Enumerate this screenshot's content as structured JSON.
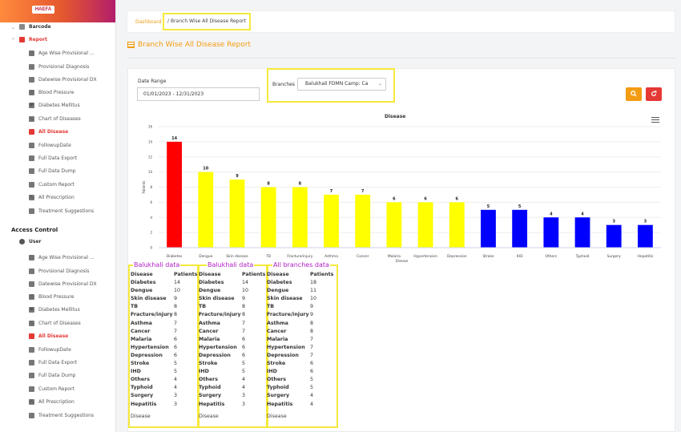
{
  "app": {
    "logo_text": "HAEFA"
  },
  "sidebar": {
    "barcode": "Barcode",
    "report": "Report",
    "report_items": [
      {
        "label": "Age Wise Provisional ...",
        "icon": "people-icon"
      },
      {
        "label": "Provisional Diagnosis",
        "icon": "document-icon"
      },
      {
        "label": "Datewise Provisional DX",
        "icon": "calendar-icon"
      },
      {
        "label": "Blood Pressure",
        "icon": "blood-pressure-icon"
      },
      {
        "label": "Diabetes Mellitus",
        "icon": "heart-icon"
      },
      {
        "label": "Chart of Diseases",
        "icon": "stethoscope-icon"
      },
      {
        "label": "All Disease",
        "icon": "clipboard-icon"
      },
      {
        "label": "FollowupDate",
        "icon": "calendar-icon"
      },
      {
        "label": "Full Data Export",
        "icon": "export-icon"
      },
      {
        "label": "Full Data Dump",
        "icon": "database-icon"
      },
      {
        "label": "Custom Report",
        "icon": "file-icon"
      },
      {
        "label": "All Prescription",
        "icon": "prescription-icon"
      },
      {
        "label": "Treatment Suggestions",
        "icon": "notes-icon"
      }
    ],
    "access_control": "Access Control",
    "user": "User",
    "user_items": [
      {
        "label": "Age Wise Provisional ...",
        "icon": "people-icon"
      },
      {
        "label": "Provisional Diagnosis",
        "icon": "document-icon"
      },
      {
        "label": "Datewise Provisional DX",
        "icon": "calendar-icon"
      },
      {
        "label": "Blood Pressure",
        "icon": "blood-pressure-icon"
      },
      {
        "label": "Diabetes Mellitus",
        "icon": "heart-icon"
      },
      {
        "label": "Chart of Diseases",
        "icon": "stethoscope-icon"
      },
      {
        "label": "All Disease",
        "icon": "clipboard-icon"
      },
      {
        "label": "FollowupDate",
        "icon": "calendar-icon"
      },
      {
        "label": "Full Data Export",
        "icon": "export-icon"
      },
      {
        "label": "Full Data Dump",
        "icon": "database-icon"
      },
      {
        "label": "Custom Report",
        "icon": "file-icon"
      },
      {
        "label": "All Prescription",
        "icon": "prescription-icon"
      },
      {
        "label": "Treatment Suggestions",
        "icon": "notes-icon"
      }
    ],
    "active_item": "All Disease"
  },
  "breadcrumb": {
    "home": "Dashboard",
    "separator": "/",
    "current": "Branch Wise All Disease Report"
  },
  "page_title": "Branch Wise All Disease Report",
  "filters": {
    "date_label": "Date Range",
    "date_value": "01/01/2023 - 12/31/2023",
    "branch_label": "Branches",
    "branch_value": "Balukhali FDMN Camp: Ca"
  },
  "colors": {
    "accent": "#f39c12",
    "danger": "#e53935",
    "bar_red": "#ff0000",
    "bar_yellow": "#ffff00",
    "bar_blue": "#0000ff",
    "highlight": "#f6e93c",
    "caption": "#b21ec8"
  },
  "chart_data": {
    "type": "bar",
    "title": "Disease",
    "xlabel": "Disease",
    "ylabel": "Patients",
    "ylim": [
      0,
      16
    ],
    "yticks": [
      0,
      2,
      4,
      6,
      8,
      10,
      12,
      14,
      16
    ],
    "categories": [
      "Diabetes",
      "Dengue",
      "Skin disease",
      "TB",
      "Fracture/injury",
      "Asthma",
      "Cancer",
      "Malaria",
      "Hypertension",
      "Depression",
      "Stroke",
      "IHD",
      "Others",
      "Typhoid",
      "Surgery",
      "Hepatitis"
    ],
    "values": [
      14,
      10,
      9,
      8,
      8,
      7,
      7,
      6,
      6,
      6,
      5,
      5,
      4,
      4,
      3,
      3
    ],
    "bar_colors": [
      "#ff0000",
      "#ffff00",
      "#ffff00",
      "#ffff00",
      "#ffff00",
      "#ffff00",
      "#ffff00",
      "#ffff00",
      "#ffff00",
      "#ffff00",
      "#0000ff",
      "#0000ff",
      "#0000ff",
      "#0000ff",
      "#0000ff",
      "#0000ff"
    ],
    "grid": true
  },
  "tables": [
    {
      "caption": "Balukhali data",
      "header": [
        "Disease",
        "Patients"
      ],
      "rows": [
        [
          "Diabetes",
          "14"
        ],
        [
          "Dengue",
          "10"
        ],
        [
          "Skin disease",
          "9"
        ],
        [
          "TB",
          "8"
        ],
        [
          "Fracture/injury",
          "8"
        ],
        [
          "Asthma",
          "7"
        ],
        [
          "Cancer",
          "7"
        ],
        [
          "Malaria",
          "6"
        ],
        [
          "Hypertension",
          "6"
        ],
        [
          "Depression",
          "6"
        ],
        [
          "Stroke",
          "5"
        ],
        [
          "IHD",
          "5"
        ],
        [
          "Others",
          "4"
        ],
        [
          "Typhoid",
          "4"
        ],
        [
          "Surgery",
          "3"
        ],
        [
          "Hepatitis",
          "3"
        ]
      ],
      "footer": "Disease"
    },
    {
      "caption": "Balukhali data",
      "header": [
        "Disease",
        "Patients"
      ],
      "rows": [
        [
          "Diabetes",
          "14"
        ],
        [
          "Dengue",
          "10"
        ],
        [
          "Skin disease",
          "9"
        ],
        [
          "TB",
          "8"
        ],
        [
          "Fracture/injury",
          "8"
        ],
        [
          "Asthma",
          "7"
        ],
        [
          "Cancer",
          "7"
        ],
        [
          "Malaria",
          "6"
        ],
        [
          "Hypertension",
          "6"
        ],
        [
          "Depression",
          "6"
        ],
        [
          "Stroke",
          "5"
        ],
        [
          "IHD",
          "5"
        ],
        [
          "Others",
          "4"
        ],
        [
          "Typhoid",
          "4"
        ],
        [
          "Surgery",
          "3"
        ],
        [
          "Hepatitis",
          "3"
        ]
      ],
      "footer": "Disease"
    },
    {
      "caption": "All branches data",
      "header": [
        "Disease",
        "Patients"
      ],
      "rows": [
        [
          "Diabetes",
          "18"
        ],
        [
          "Dengue",
          "11"
        ],
        [
          "Skin disease",
          "10"
        ],
        [
          "TB",
          "9"
        ],
        [
          "Fracture/injury",
          "9"
        ],
        [
          "Asthma",
          "8"
        ],
        [
          "Cancer",
          "8"
        ],
        [
          "Malaria",
          "7"
        ],
        [
          "Hypertension",
          "7"
        ],
        [
          "Depression",
          "7"
        ],
        [
          "Stroke",
          "6"
        ],
        [
          "IHD",
          "6"
        ],
        [
          "Others",
          "5"
        ],
        [
          "Typhoid",
          "5"
        ],
        [
          "Surgery",
          "4"
        ],
        [
          "Hepatitis",
          "4"
        ]
      ],
      "footer": "Disease"
    }
  ]
}
